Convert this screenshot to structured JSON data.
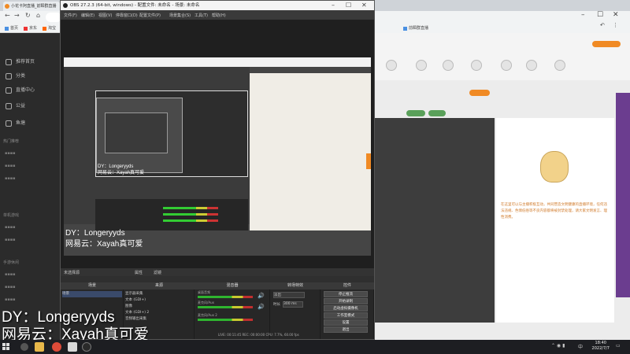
{
  "browser": {
    "tab_title": "小花卡阿直播_前瞬群直播",
    "bookmarks": [
      "首页",
      "京东",
      "淘宝",
      "前瞬群直播"
    ],
    "right_text": "前瞬群"
  },
  "douyu": {
    "left_nav": [
      "推荐首页",
      "分类",
      "直播中心",
      "公益",
      "鱼塘",
      "任务"
    ],
    "sections": [
      "热门推荐",
      "单机游戏",
      "手游休闲"
    ],
    "notice": "在这里可以与主播积极互动，共同营造文明健康的直播环境，任何违法违规、色情低俗等不良内容都将被封禁处理，请大家文明发言、理性消费。"
  },
  "obs": {
    "title": "OBS 27.2.3 (64-bit, windows) - 配置文件: 未命名 - 场景: 未命名",
    "menu": [
      "文件(F)",
      "编辑(E)",
      "视图(V)",
      "停靠窗口(D)",
      "配置文件(P)",
      "场景集合(S)",
      "工具(T)",
      "帮助(H)"
    ],
    "status": "未选择源",
    "props_btn": "属性",
    "filter_btn": "滤镜",
    "docks": {
      "scenes": "场景",
      "sources": "来源",
      "mixer": "混音器",
      "transitions": "转场特效",
      "controls": "控件"
    },
    "scene_item": "场景",
    "source_items": [
      "显示器采集",
      "文本 (GDI+)",
      "图像",
      "文本 (GDI+) 2",
      "音频输出采集"
    ],
    "mixer_items": [
      "桌面音频",
      "麦克风/Aux",
      "麦克风/Aux 2"
    ],
    "transition": "淡出",
    "duration_label": "时长",
    "duration_value": "300 ms",
    "control_buttons": [
      "停止推流",
      "开始录制",
      "启动虚拟摄像机",
      "工作室模式",
      "设置",
      "退出"
    ],
    "status_bar": "LIVE: 00:11:45  REC: 00:00:00  CPU: 7.7%, 60.00 fps"
  },
  "overlay": {
    "line1": "DY：Longeryyds",
    "line2": "网易云：Xayah真可爱"
  },
  "taskbar": {
    "time": "18:40",
    "date": "2022/7/7",
    "lang": "中"
  }
}
